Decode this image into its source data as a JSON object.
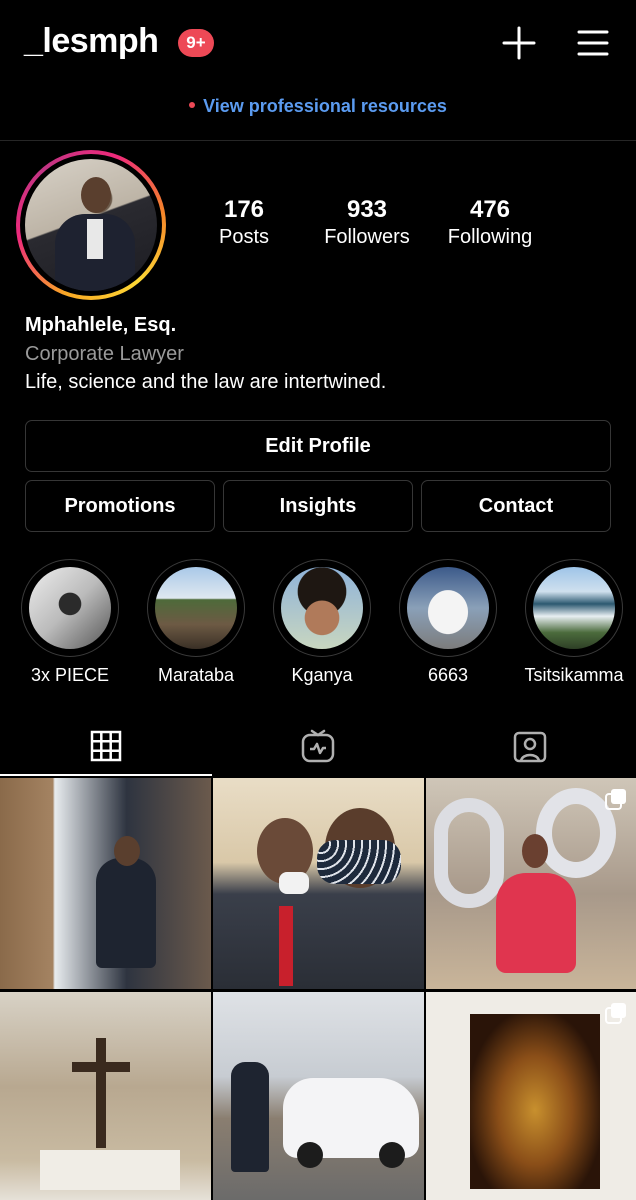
{
  "header": {
    "username": "_lesmph",
    "notification_badge": "9+",
    "icons": [
      "plus-icon",
      "menu-icon"
    ]
  },
  "professional_banner": {
    "text": "View professional resources"
  },
  "profile": {
    "stats": [
      {
        "value": "176",
        "label": "Posts"
      },
      {
        "value": "933",
        "label": "Followers"
      },
      {
        "value": "476",
        "label": "Following"
      }
    ],
    "name": "Mphahlele, Esq.",
    "category": "Corporate Lawyer",
    "bio": "Life, science and the law are intertwined."
  },
  "buttons": {
    "edit_profile": "Edit Profile",
    "promotions": "Promotions",
    "insights": "Insights",
    "contact": "Contact"
  },
  "highlights": [
    {
      "label": "3x PIECE"
    },
    {
      "label": "Marataba"
    },
    {
      "label": "Kganya"
    },
    {
      "label": "6663"
    },
    {
      "label": "Tsitsikamma"
    }
  ],
  "tabs": [
    {
      "icon": "grid-icon",
      "active": true
    },
    {
      "icon": "igtv-icon",
      "active": false
    },
    {
      "icon": "tagged-icon",
      "active": false
    }
  ],
  "colors": {
    "badge": "#ed4956",
    "link": "#5b9bf0",
    "border": "#363636",
    "muted": "#9a9a9a"
  }
}
